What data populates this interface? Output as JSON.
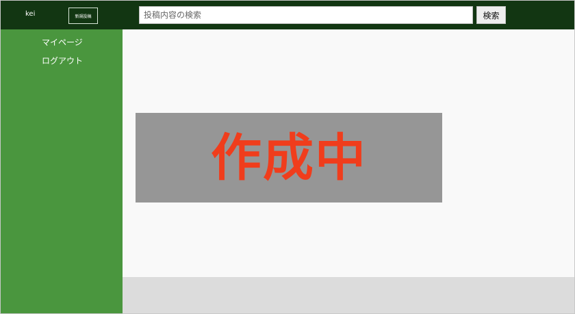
{
  "header": {
    "username": "kei",
    "new_post_label": "新規投稿",
    "search": {
      "placeholder": "投稿内容の検索",
      "value": "",
      "button_label": "検索"
    }
  },
  "sidebar": {
    "items": [
      {
        "label": "マイページ"
      },
      {
        "label": "ログアウト"
      }
    ]
  },
  "main": {
    "banner_text": "作成中"
  },
  "colors": {
    "header_bg": "#123612",
    "sidebar_bg": "#4a963e",
    "main_bg": "#f9f9f9",
    "banner_bg": "#969696",
    "banner_text": "#f03d1c",
    "footer_bg": "#dcdcdc"
  }
}
